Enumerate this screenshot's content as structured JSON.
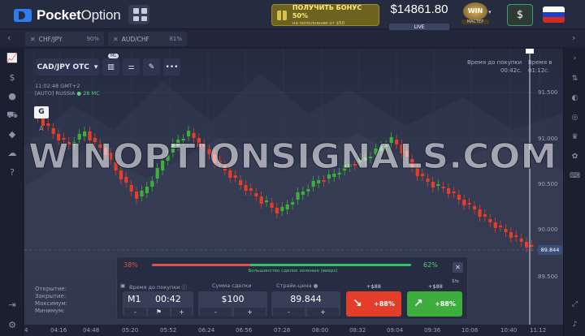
{
  "header": {
    "logo_bold": "Pocket",
    "logo_thin": "Option",
    "bonus_title": "ПОЛУЧИТЬ БОНУС 50%",
    "bonus_sub": "на пополнение от $50",
    "balance": "$14861.80",
    "account_type": "LIVE",
    "level_badge": "WIN",
    "level_label": "МАСТЕР",
    "deposit_symbol": "$",
    "brand_color": "#2d7df0"
  },
  "asset_tabs": [
    {
      "name": "CHF/JPY",
      "payout": "90%"
    },
    {
      "name": "AUD/CHF",
      "payout": "81%"
    }
  ],
  "chart_header": {
    "asset": "CAD/JPY OTC",
    "ml_badge": "ML",
    "time": "11:02:48 GMT+2",
    "provider": "[AUTO] RUSSIA",
    "ma_label": "28 MC",
    "g_badge": "G",
    "a_label": "A",
    "purchase_time_label": "Время до покупки",
    "purchase_time_value": "00:42с.",
    "expiry_label": "Время в",
    "expiry_value": "01:12с."
  },
  "price_axis": [
    "91.500",
    "91.000",
    "90.500",
    "90.000",
    "89.500"
  ],
  "current_price": "89.844",
  "time_axis": [
    "4",
    "04:16",
    "04:48",
    "05:20",
    "05:52",
    "06:24",
    "06:56",
    "07:28",
    "08:00",
    "08:32",
    "09:04",
    "09:36",
    "10:08",
    "10:40",
    "11:12"
  ],
  "watermark": "WINOPTIONSIGNALS.COM",
  "stats_labels": [
    "Открытие:",
    "Закрытие:",
    "Максимум:",
    "Минимум:"
  ],
  "trade_panel": {
    "sentiment_sell": "38%",
    "sentiment_buy": "62%",
    "sentiment_sell_value": 38,
    "sentiment_text": "Большинство сделок зеленые (вверх)",
    "close": "✕",
    "time_label": "Время до покупки",
    "timeframe": "M1",
    "time_value": "00:42",
    "amount_label": "Сумма сделки",
    "amount_value": "$100",
    "strike_label": "Страйк-цена",
    "strike_value": "89.844",
    "put_win": "+$88",
    "call_win": "+$88",
    "put_pct": "+88%",
    "call_pct": "+88%",
    "minus": "-",
    "plus": "+",
    "flag_icon": "⚑",
    "put_color": "#e43e2b",
    "call_color": "#3dae3e"
  },
  "chart_data": {
    "type": "candlestick",
    "ylim": [
      89.4,
      91.7
    ],
    "up_color": "#3dae3e",
    "down_color": "#e43e2b"
  }
}
